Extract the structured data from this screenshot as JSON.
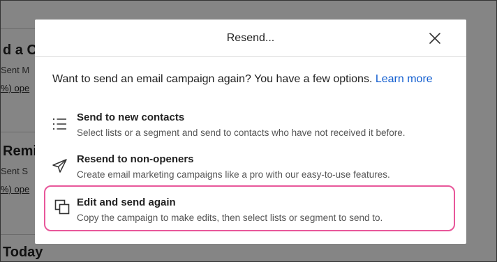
{
  "background": {
    "items": [
      {
        "title": "d a C",
        "sub": "Sent M",
        "link": "%) ope"
      },
      {
        "title": "Remi",
        "sub": "Sent S",
        "link": "%) ope"
      },
      {
        "title": "Today"
      }
    ]
  },
  "modal": {
    "title": "Resend...",
    "close_icon": "close-icon",
    "intro_text": "Want to send an email campaign again? You have a few options.",
    "learn_more": "Learn more",
    "options": [
      {
        "icon": "list-icon",
        "title": "Send to new contacts",
        "description": "Select lists or a segment and send to contacts who have not received it before."
      },
      {
        "icon": "paper-plane-icon",
        "title": "Resend to non-openers",
        "description": "Create email marketing campaigns like a pro with our easy-to-use features."
      },
      {
        "icon": "copy-icon",
        "title": "Edit and send again",
        "description": "Copy the campaign to make edits, then select lists or segment to send to."
      }
    ]
  },
  "colors": {
    "highlight_border": "#e8579a",
    "link": "#0f5ccf",
    "overlay": "rgba(0,0,0,0.48)"
  }
}
